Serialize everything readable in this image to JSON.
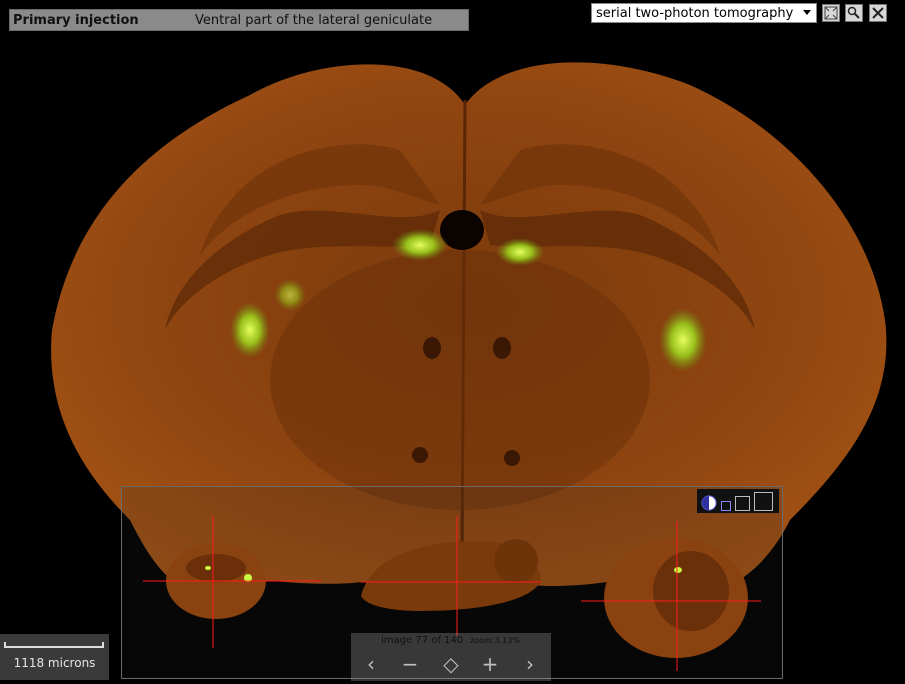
{
  "header": {
    "label": "Primary injection",
    "value": "Ventral part of the lateral geniculate"
  },
  "toolbar": {
    "modality_selected": "serial two-photon tomography",
    "buttons": [
      "fullscreen-icon",
      "magnify-icon",
      "tools-icon"
    ]
  },
  "navigator": {
    "view_modes": [
      "contrast-icon",
      "small-view-icon",
      "medium-view-icon",
      "large-view-icon"
    ]
  },
  "scale_bar": {
    "label": "1118 microns"
  },
  "counter": {
    "image_label": "image 77 of 140",
    "zoom_label": "zoom:3.13%",
    "controls": [
      "‹",
      "−",
      "◇",
      "+",
      "›"
    ]
  },
  "colors": {
    "tissue": "#9a4a10",
    "fluorescence": "#b8ff2a",
    "crosshair": "#ff1a1a"
  }
}
